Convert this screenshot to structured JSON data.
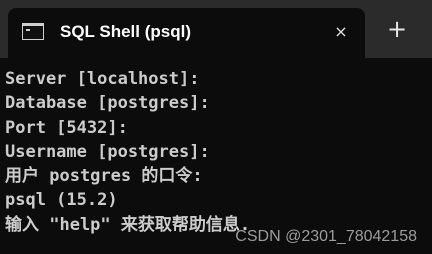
{
  "window": {
    "tab_title": "SQL Shell (psql)",
    "tab_close_icon": "×",
    "new_tab_icon": "+"
  },
  "terminal": {
    "lines": [
      "Server [localhost]:",
      "Database [postgres]:",
      "Port [5432]:",
      "Username [postgres]:",
      "用户 postgres 的口令:",
      "psql (15.2)",
      "输入 \"help\" 来获取帮助信息."
    ]
  },
  "watermark": "CSDN @2301_78042158",
  "colors": {
    "background": "#0c0c0c",
    "tabbar": "#2b2b2b",
    "text": "#cccccc"
  }
}
